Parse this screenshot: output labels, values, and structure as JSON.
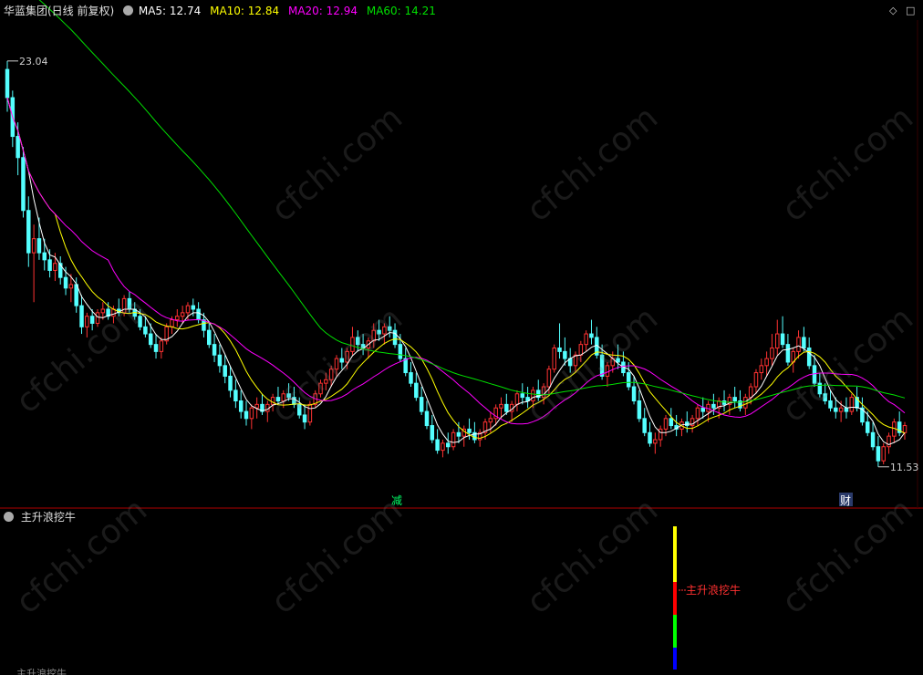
{
  "header": {
    "title": "华蓝集团(日线 前复权)",
    "ma5_label": "MA5: 12.74",
    "ma10_label": "MA10: 12.84",
    "ma20_label": "MA20: 12.94",
    "ma60_label": "MA60: 14.21",
    "indicator_title": "主升浪挖牛",
    "bottom_cut_label": "主升浪挖牛"
  },
  "colors": {
    "background": "#000000",
    "up_candle": "#ff3232",
    "down_candle": "#54ffff",
    "ma5": "#ffffff",
    "ma10": "#ffff00",
    "ma20": "#ff00ff",
    "ma60": "#00e000",
    "divider": "#b00000",
    "watermark": "cfchi.com"
  },
  "chart_data": {
    "type": "candlestick",
    "ylim": [
      10.8,
      24.2
    ],
    "candles": [
      [
        22.8,
        23.04,
        21.6,
        22.0
      ],
      [
        22.0,
        22.2,
        20.6,
        20.9
      ],
      [
        20.9,
        21.3,
        19.8,
        20.3
      ],
      [
        20.3,
        20.6,
        18.6,
        18.8
      ],
      [
        18.8,
        19.2,
        17.2,
        17.6
      ],
      [
        17.6,
        18.4,
        16.2,
        18.0
      ],
      [
        18.0,
        18.6,
        17.4,
        17.6
      ],
      [
        17.6,
        18.0,
        17.1,
        17.4
      ],
      [
        17.4,
        17.7,
        16.9,
        17.1
      ],
      [
        17.1,
        17.6,
        16.8,
        17.3
      ],
      [
        17.3,
        17.5,
        16.7,
        16.9
      ],
      [
        16.9,
        17.2,
        16.4,
        16.6
      ],
      [
        16.6,
        17.0,
        16.2,
        16.7
      ],
      [
        16.7,
        16.9,
        15.9,
        16.1
      ],
      [
        16.1,
        16.4,
        15.3,
        15.5
      ],
      [
        15.5,
        15.9,
        15.2,
        15.8
      ],
      [
        15.8,
        16.0,
        15.4,
        15.6
      ],
      [
        15.6,
        16.0,
        15.5,
        15.9
      ],
      [
        15.9,
        16.2,
        15.7,
        16.0
      ],
      [
        16.0,
        16.2,
        15.7,
        15.8
      ],
      [
        15.8,
        16.1,
        15.6,
        16.0
      ],
      [
        16.0,
        16.3,
        15.8,
        15.9
      ],
      [
        15.9,
        16.4,
        15.8,
        16.3
      ],
      [
        16.3,
        16.5,
        15.9,
        16.0
      ],
      [
        16.0,
        16.2,
        15.7,
        15.8
      ],
      [
        15.8,
        16.0,
        15.4,
        15.5
      ],
      [
        15.5,
        15.8,
        15.2,
        15.3
      ],
      [
        15.3,
        15.6,
        14.9,
        15.0
      ],
      [
        15.0,
        15.3,
        14.6,
        14.8
      ],
      [
        14.8,
        15.2,
        14.6,
        15.1
      ],
      [
        15.1,
        15.6,
        15.0,
        15.5
      ],
      [
        15.5,
        15.8,
        15.3,
        15.7
      ],
      [
        15.7,
        16.0,
        15.5,
        15.8
      ],
      [
        15.8,
        16.1,
        15.6,
        15.9
      ],
      [
        15.9,
        16.2,
        15.7,
        16.1
      ],
      [
        16.1,
        16.3,
        15.8,
        16.0
      ],
      [
        16.0,
        16.2,
        15.6,
        15.7
      ],
      [
        15.7,
        15.9,
        15.2,
        15.4
      ],
      [
        15.4,
        15.6,
        14.9,
        15.0
      ],
      [
        15.0,
        15.3,
        14.5,
        14.7
      ],
      [
        14.7,
        15.0,
        14.2,
        14.4
      ],
      [
        14.4,
        14.7,
        13.9,
        14.1
      ],
      [
        14.1,
        14.4,
        13.5,
        13.7
      ],
      [
        13.7,
        14.0,
        13.2,
        13.4
      ],
      [
        13.4,
        13.7,
        12.9,
        13.1
      ],
      [
        13.1,
        13.4,
        12.7,
        12.9
      ],
      [
        12.9,
        13.3,
        12.6,
        13.2
      ],
      [
        13.2,
        13.5,
        12.9,
        13.3
      ],
      [
        13.3,
        13.6,
        13.0,
        13.1
      ],
      [
        13.1,
        13.4,
        12.8,
        13.3
      ],
      [
        13.3,
        13.6,
        13.1,
        13.5
      ],
      [
        13.5,
        13.8,
        13.3,
        13.4
      ],
      [
        13.4,
        13.7,
        13.2,
        13.6
      ],
      [
        13.6,
        13.9,
        13.4,
        13.5
      ],
      [
        13.5,
        13.8,
        13.2,
        13.3
      ],
      [
        13.3,
        13.5,
        12.9,
        13.0
      ],
      [
        13.0,
        13.3,
        12.6,
        12.8
      ],
      [
        12.8,
        13.4,
        12.7,
        13.3
      ],
      [
        13.3,
        13.7,
        13.2,
        13.6
      ],
      [
        13.6,
        14.0,
        13.5,
        13.9
      ],
      [
        13.9,
        14.2,
        13.7,
        14.0
      ],
      [
        14.0,
        14.4,
        13.8,
        14.3
      ],
      [
        14.3,
        14.7,
        14.1,
        14.6
      ],
      [
        14.6,
        14.9,
        14.3,
        14.5
      ],
      [
        14.5,
        14.9,
        14.3,
        14.8
      ],
      [
        14.8,
        15.5,
        14.7,
        15.2
      ],
      [
        15.2,
        15.4,
        14.8,
        15.0
      ],
      [
        15.0,
        15.3,
        14.7,
        14.9
      ],
      [
        14.9,
        15.2,
        14.6,
        15.1
      ],
      [
        15.1,
        15.6,
        14.9,
        15.4
      ],
      [
        15.4,
        15.7,
        15.1,
        15.3
      ],
      [
        15.3,
        15.6,
        15.0,
        15.5
      ],
      [
        15.5,
        15.8,
        15.2,
        15.4
      ],
      [
        15.4,
        15.6,
        14.9,
        15.0
      ],
      [
        15.0,
        15.3,
        14.5,
        14.6
      ],
      [
        14.6,
        14.9,
        14.1,
        14.2
      ],
      [
        14.2,
        14.5,
        13.8,
        13.9
      ],
      [
        13.9,
        14.2,
        13.4,
        13.5
      ],
      [
        13.5,
        13.8,
        13.0,
        13.1
      ],
      [
        13.1,
        13.4,
        12.6,
        12.7
      ],
      [
        12.7,
        13.0,
        12.2,
        12.3
      ],
      [
        12.3,
        12.6,
        11.9,
        12.0
      ],
      [
        12.0,
        12.3,
        11.8,
        12.2
      ],
      [
        12.2,
        12.5,
        11.9,
        12.1
      ],
      [
        12.1,
        12.6,
        12.0,
        12.5
      ],
      [
        12.5,
        12.8,
        12.2,
        12.4
      ],
      [
        12.4,
        12.7,
        12.1,
        12.6
      ],
      [
        12.6,
        12.9,
        12.3,
        12.5
      ],
      [
        12.5,
        12.8,
        12.2,
        12.3
      ],
      [
        12.3,
        12.6,
        12.1,
        12.5
      ],
      [
        12.5,
        12.9,
        12.3,
        12.8
      ],
      [
        12.8,
        13.1,
        12.5,
        12.9
      ],
      [
        12.9,
        13.3,
        12.7,
        13.2
      ],
      [
        13.2,
        13.5,
        12.9,
        13.3
      ],
      [
        13.3,
        13.6,
        13.0,
        13.1
      ],
      [
        13.1,
        13.4,
        12.8,
        13.3
      ],
      [
        13.3,
        13.7,
        13.1,
        13.6
      ],
      [
        13.6,
        13.9,
        13.3,
        13.5
      ],
      [
        13.5,
        13.8,
        13.2,
        13.4
      ],
      [
        13.4,
        13.8,
        13.2,
        13.7
      ],
      [
        13.7,
        14.0,
        13.4,
        13.5
      ],
      [
        13.5,
        13.9,
        13.3,
        13.8
      ],
      [
        13.8,
        14.4,
        13.6,
        14.3
      ],
      [
        14.3,
        15.0,
        14.2,
        14.9
      ],
      [
        14.9,
        15.6,
        14.6,
        14.8
      ],
      [
        14.8,
        15.2,
        14.4,
        14.6
      ],
      [
        14.6,
        14.9,
        14.2,
        14.4
      ],
      [
        14.4,
        14.8,
        14.2,
        14.7
      ],
      [
        14.7,
        15.1,
        14.5,
        15.0
      ],
      [
        15.0,
        15.4,
        14.8,
        15.3
      ],
      [
        15.3,
        15.7,
        15.0,
        15.2
      ],
      [
        15.2,
        15.5,
        14.6,
        14.7
      ],
      [
        14.7,
        15.0,
        14.0,
        14.1
      ],
      [
        14.1,
        14.5,
        13.8,
        14.4
      ],
      [
        14.4,
        14.8,
        14.2,
        14.6
      ],
      [
        14.6,
        15.0,
        14.3,
        14.5
      ],
      [
        14.5,
        14.8,
        14.1,
        14.2
      ],
      [
        14.2,
        14.5,
        13.7,
        13.8
      ],
      [
        13.8,
        14.1,
        13.3,
        13.4
      ],
      [
        13.4,
        13.7,
        12.8,
        12.9
      ],
      [
        12.9,
        13.2,
        12.4,
        12.5
      ],
      [
        12.5,
        12.8,
        12.1,
        12.2
      ],
      [
        12.2,
        12.5,
        11.9,
        12.3
      ],
      [
        12.3,
        12.7,
        12.1,
        12.6
      ],
      [
        12.6,
        13.0,
        12.4,
        12.9
      ],
      [
        12.9,
        13.2,
        12.6,
        12.7
      ],
      [
        12.7,
        13.0,
        12.4,
        12.6
      ],
      [
        12.6,
        12.9,
        12.4,
        12.8
      ],
      [
        12.8,
        13.1,
        12.5,
        12.7
      ],
      [
        12.7,
        13.0,
        12.5,
        12.9
      ],
      [
        12.9,
        13.3,
        12.7,
        13.2
      ],
      [
        13.2,
        13.5,
        12.9,
        13.1
      ],
      [
        13.1,
        13.4,
        12.8,
        13.3
      ],
      [
        13.3,
        13.6,
        13.0,
        13.2
      ],
      [
        13.2,
        13.5,
        12.9,
        13.4
      ],
      [
        13.4,
        13.7,
        13.1,
        13.3
      ],
      [
        13.3,
        13.6,
        13.0,
        13.5
      ],
      [
        13.5,
        13.8,
        13.2,
        13.4
      ],
      [
        13.4,
        13.7,
        13.1,
        13.2
      ],
      [
        13.2,
        13.6,
        13.0,
        13.5
      ],
      [
        13.5,
        13.9,
        13.3,
        13.8
      ],
      [
        13.8,
        14.3,
        13.6,
        14.2
      ],
      [
        14.2,
        14.6,
        14.0,
        14.4
      ],
      [
        14.4,
        14.8,
        14.1,
        14.6
      ],
      [
        14.6,
        15.3,
        14.4,
        14.9
      ],
      [
        14.9,
        15.7,
        14.7,
        15.3
      ],
      [
        15.3,
        15.8,
        14.9,
        15.0
      ],
      [
        15.0,
        15.3,
        14.4,
        14.5
      ],
      [
        14.5,
        14.9,
        14.2,
        14.8
      ],
      [
        14.8,
        15.4,
        14.6,
        15.2
      ],
      [
        15.2,
        15.5,
        14.8,
        14.9
      ],
      [
        14.9,
        15.2,
        14.3,
        14.4
      ],
      [
        14.4,
        14.7,
        13.8,
        13.9
      ],
      [
        13.9,
        14.2,
        13.5,
        13.6
      ],
      [
        13.6,
        13.9,
        13.3,
        13.4
      ],
      [
        13.4,
        13.7,
        13.1,
        13.2
      ],
      [
        13.2,
        13.5,
        12.9,
        13.1
      ],
      [
        13.1,
        13.4,
        12.8,
        13.2
      ],
      [
        13.2,
        13.5,
        12.9,
        13.1
      ],
      [
        13.1,
        13.6,
        13.0,
        13.5
      ],
      [
        13.5,
        13.8,
        13.1,
        13.2
      ],
      [
        13.2,
        13.5,
        12.7,
        12.8
      ],
      [
        12.8,
        13.1,
        12.4,
        12.5
      ],
      [
        12.5,
        12.8,
        12.0,
        12.1
      ],
      [
        12.1,
        12.4,
        11.53,
        11.7
      ],
      [
        11.7,
        12.2,
        11.6,
        12.1
      ],
      [
        12.1,
        12.5,
        11.9,
        12.4
      ],
      [
        12.4,
        12.9,
        12.2,
        12.8
      ],
      [
        12.8,
        13.1,
        12.4,
        12.5
      ],
      [
        12.5,
        12.8,
        12.3,
        12.7
      ]
    ],
    "annotations": [
      {
        "text": "23.04",
        "type": "high"
      },
      {
        "text": "11.53",
        "type": "low"
      },
      {
        "text": "减",
        "type": "marker"
      },
      {
        "text": "财",
        "type": "marker"
      }
    ],
    "indicator": {
      "title": "主升浪挖牛",
      "signal_label": "主升浪挖牛",
      "signal_bar_colors": [
        "#ffff00",
        "#ff0000",
        "#00ff00",
        "#0000ff"
      ]
    }
  }
}
